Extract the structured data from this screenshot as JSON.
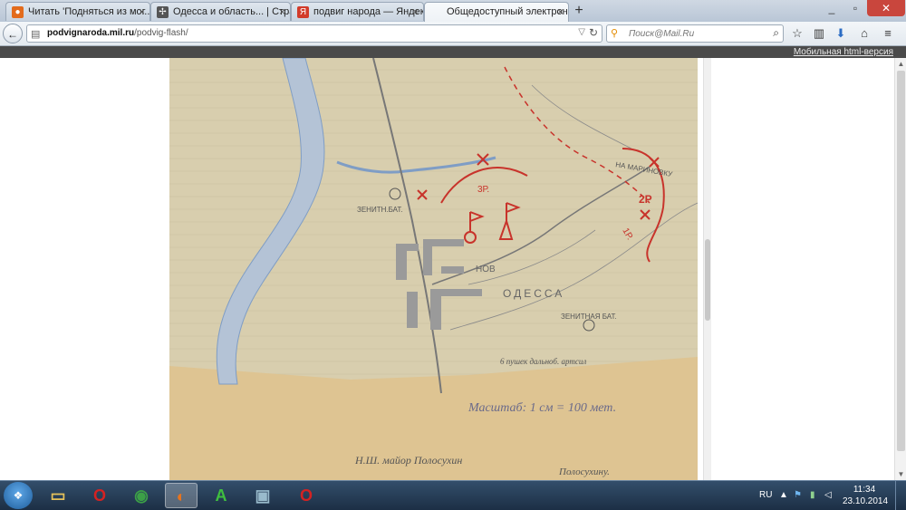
{
  "tabs": [
    {
      "label": "Читать 'Подняться из мог...",
      "favicon_color": "#e36b1c",
      "active": false
    },
    {
      "label": "Одесса и область... | Стран...",
      "favicon_color": "#555555",
      "active": false
    },
    {
      "label": "подвиг народа — Яндекс: ...",
      "favicon_color": "#d23b2a",
      "active": false
    },
    {
      "label": "Общедоступный электронный ...",
      "favicon_color": "#3d6b9b",
      "active": true
    }
  ],
  "urlbar": {
    "domain": "podvignaroda.mil.ru",
    "path": "/podvig-flash/"
  },
  "search": {
    "placeholder": "Поиск@Mail.Ru"
  },
  "mobile_link": "Мобильная html-версия",
  "map_labels": {
    "zenith_top": "ЗЕНИТН.БАТ.",
    "nov": "НОВ",
    "odessa": "ОДЕССА",
    "zenith_bottom": "ЗЕНИТНАЯ БАТ.",
    "guns": "6 пушек дальноб. артсил",
    "scale": "Масштаб: 1 см = 100 мет.",
    "signature": "Н.Ш. майор Полосухин",
    "signature_name": "Полосухину.",
    "na_marinovku": "НА МАРИНОВКУ",
    "unit_3r": "3Р.",
    "unit_2r": "2Р",
    "unit_1r": "1Р."
  },
  "taskbar": {
    "lang": "RU",
    "time": "11:34",
    "date": "23.10.2014"
  },
  "colors": {
    "pencil_red": "#c8332b",
    "pencil_blue": "#7f9dc5",
    "pencil_gray": "#777777",
    "paper": "#d8ceae"
  }
}
